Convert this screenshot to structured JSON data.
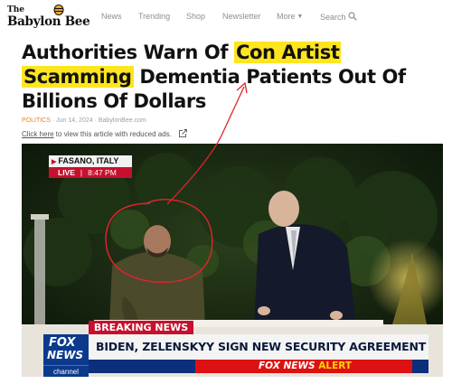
{
  "nav": {
    "logo_small": "The",
    "logo_big": "Babylon Bee",
    "items": [
      "News",
      "Trending",
      "Shop",
      "Newsletter",
      "More",
      "Search"
    ]
  },
  "article": {
    "headline_part1": "Authorities Warn Of ",
    "headline_highlight1": "Con Artist",
    "headline_highlight2": "Scamming",
    "headline_part2": " Dementia Patients Out Of Billions Of Dollars",
    "category": "POLITICS",
    "date": "Jun 14, 2024",
    "source": "BabylonBee.com",
    "reduced_link": "Click here",
    "reduced_text": " to view this article with reduced ads."
  },
  "video": {
    "location": "FASANO, ITALY",
    "live": "LIVE",
    "time": "8:47 PM",
    "breaking": "BREAKING NEWS",
    "ticker": "BIDEN, ZELENSKYY SIGN NEW SECURITY AGREEMENT",
    "fox": "FOX",
    "news": "NEWS",
    "channel": "channel",
    "alert_fox": "FOX NEWS",
    "alert_word": "ALERT"
  },
  "colors": {
    "highlight": "#fde51f",
    "annotation_red": "#e3242b",
    "fox_red": "#c8102e",
    "fox_blue": "#0b3a8c",
    "category_orange": "#e8832a"
  }
}
